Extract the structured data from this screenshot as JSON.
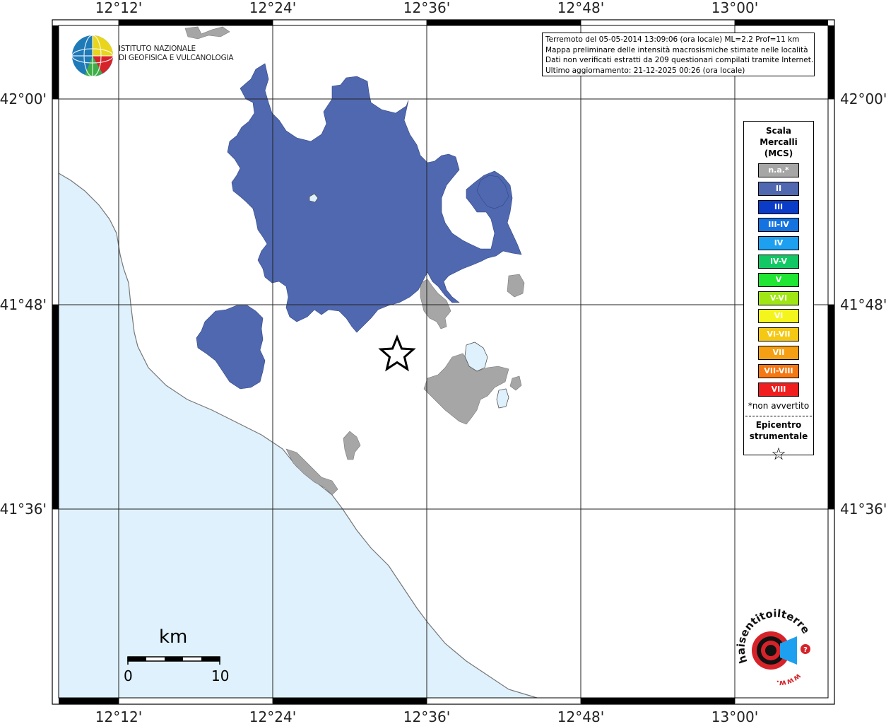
{
  "map": {
    "lon_labels": [
      "12°12'",
      "12°24'",
      "12°36'",
      "12°48'",
      "13°00'"
    ],
    "lat_labels": [
      "42°00'",
      "41°48'",
      "41°36'"
    ],
    "colors": {
      "sea": "#dff1fc",
      "land": "#ffffff",
      "intensity_II": "#5068b0",
      "not_felt": "#a6a6a6",
      "lake": "#dff1fc",
      "grid": "#222222"
    },
    "epicenter_symbol": "star"
  },
  "info_box": {
    "line1": "Terremoto del 05-05-2014 13:09:06 (ora locale) ML=2.2 Prof=11 km",
    "line2": "Mappa preliminare delle intensità macrosismiche stimate nelle località",
    "line3": "Dati non verificati estratti da 209 questionari compilati tramite Internet.",
    "line4": "Ultimo aggiornamento: 21-12-2025 00:26 (ora locale)"
  },
  "logo": {
    "org_line1": "ISTITUTO NAZIONALE",
    "org_line2": "DI GEOFISICA E VULCANOLOGIA"
  },
  "legend": {
    "title_line1": "Scala",
    "title_line2": "Mercalli",
    "title_line3": "(MCS)",
    "items": [
      {
        "label": "n.a.*",
        "color": "#a6a6a6"
      },
      {
        "label": "II",
        "color": "#5068b0"
      },
      {
        "label": "III",
        "color": "#0a3cc8"
      },
      {
        "label": "III-IV",
        "color": "#1473e0"
      },
      {
        "label": "IV",
        "color": "#1ea0f0"
      },
      {
        "label": "IV-V",
        "color": "#12c864"
      },
      {
        "label": "V",
        "color": "#1ee632"
      },
      {
        "label": "V-VI",
        "color": "#a0e614"
      },
      {
        "label": "VI",
        "color": "#f5f51e"
      },
      {
        "label": "VI-VII",
        "color": "#f5c814"
      },
      {
        "label": "VII",
        "color": "#f5a014"
      },
      {
        "label": "VII-VIII",
        "color": "#f57814"
      },
      {
        "label": "VIII",
        "color": "#f01e1e"
      }
    ],
    "note": "*non avvertito",
    "epicenter_line1": "Epicentro",
    "epicenter_line2": "strumentale",
    "epicenter_symbol": "☆"
  },
  "scale_bar": {
    "unit": "km",
    "start": "0",
    "end": "10"
  },
  "branding": {
    "site_text": "haisentitoilterremoto.it",
    "www_text": "www."
  }
}
